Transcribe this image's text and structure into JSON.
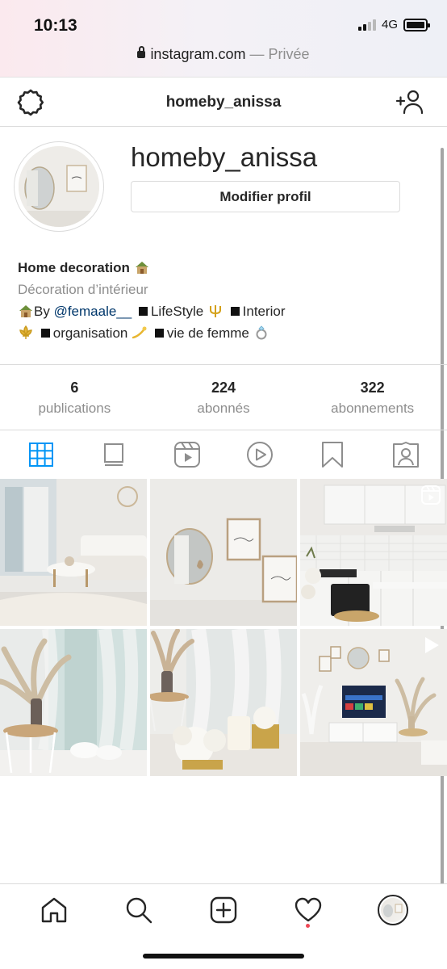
{
  "status_bar": {
    "time": "10:13",
    "network": "4G"
  },
  "browser": {
    "url": "instagram.com",
    "separator": "—",
    "mode": "Privée"
  },
  "header": {
    "title": "homeby_anissa",
    "settings_icon": "gear-icon",
    "add_user_icon": "add-user-icon"
  },
  "profile": {
    "username": "homeby_anissa",
    "edit_label": "Modifier profil"
  },
  "bio": {
    "name": "Home decoration",
    "category": "Décoration d’intérieur",
    "line1_by": "By",
    "line1_mention": "@femaale__",
    "line1_lifestyle": "LifeStyle",
    "line1_interior": "Interior",
    "line2_organisation": "organisation",
    "line2_vie": "vie de femme",
    "emojis": [
      "house-emoji",
      "trident-emoji",
      "fleur-de-lis-emoji",
      "dizzy-emoji",
      "ring-emoji"
    ]
  },
  "stats": [
    {
      "value": "6",
      "label": "publications"
    },
    {
      "value": "224",
      "label": "abonnés"
    },
    {
      "value": "322",
      "label": "abonnements"
    }
  ],
  "tabs": [
    {
      "name": "grid",
      "icon": "grid-icon",
      "active": true
    },
    {
      "name": "guides",
      "icon": "guide-icon",
      "active": false
    },
    {
      "name": "reels",
      "icon": "reels-icon",
      "active": false
    },
    {
      "name": "igtv",
      "icon": "igtv-icon",
      "active": false
    },
    {
      "name": "saved",
      "icon": "bookmark-icon",
      "active": false
    },
    {
      "name": "tagged",
      "icon": "tagged-icon",
      "active": false
    }
  ],
  "posts": [
    {
      "subject": "living room",
      "badge": ""
    },
    {
      "subject": "mirror wall",
      "badge": ""
    },
    {
      "subject": "kitchen",
      "badge": "reel-icon"
    },
    {
      "subject": "pampas side table",
      "badge": ""
    },
    {
      "subject": "candle table",
      "badge": ""
    },
    {
      "subject": "tv wall",
      "badge": "play-icon"
    }
  ],
  "bottom_nav": [
    "home-icon",
    "search-icon",
    "new-post-icon",
    "activity-heart-icon",
    "profile-avatar"
  ],
  "colors": {
    "accent": "#0095f6",
    "link": "#00376b",
    "muted": "#8e8e8e",
    "border": "#dbdbdb",
    "notification": "#ed4956"
  }
}
